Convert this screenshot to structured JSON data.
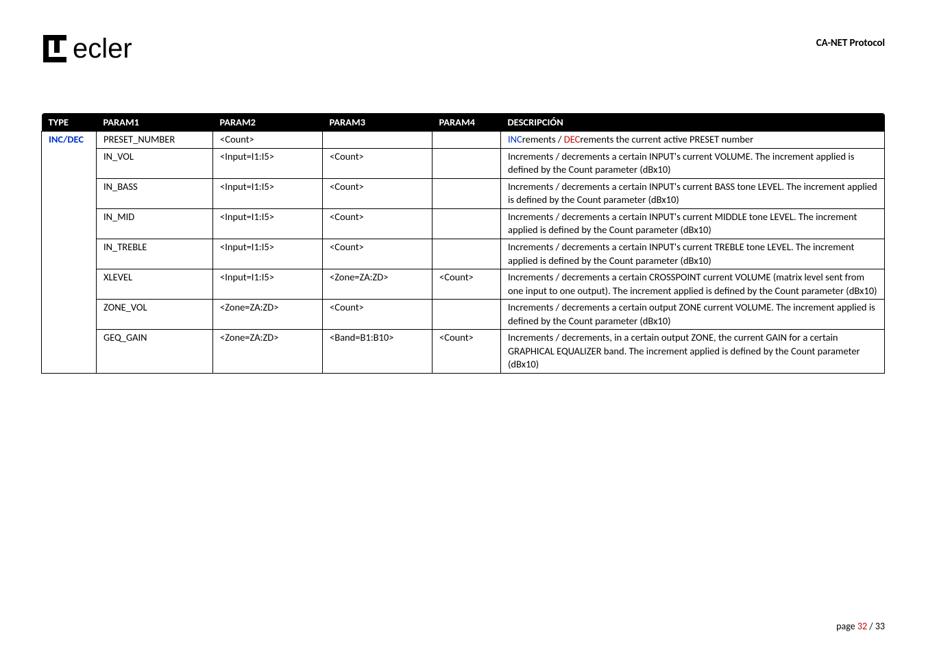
{
  "header": {
    "logo_text": "ecler",
    "doc_title": "CA-NET Protocol"
  },
  "table": {
    "headers": {
      "type": "TYPE",
      "param1": "PARAM1",
      "param2": "PARAM2",
      "param3": "PARAM3",
      "param4": "PARAM4",
      "desc": "DESCRIPCIÓN"
    },
    "type_label": "INC/DEC",
    "rows": [
      {
        "param1": "PRESET_NUMBER",
        "param2": "<Count>",
        "param3": "",
        "param4": "",
        "desc_prefix_inc": "INC",
        "desc_mid1": "rements / ",
        "desc_prefix_dec": "DEC",
        "desc_rest": "rements the current active PRESET number"
      },
      {
        "param1": "IN_VOL",
        "param2": "<Input=I1:I5>",
        "param3": "<Count>",
        "param4": "",
        "desc": "Increments / decrements a certain INPUT's  current VOLUME. The increment applied is defined by the Count parameter (dBx10)"
      },
      {
        "param1": "IN_BASS",
        "param2": "<Input=I1:I5>",
        "param3": "<Count>",
        "param4": "",
        "desc": "Increments / decrements a certain INPUT's current BASS tone LEVEL. The increment applied is defined by the Count parameter (dBx10)"
      },
      {
        "param1": "IN_MID",
        "param2": "<Input=I1:I5>",
        "param3": "<Count>",
        "param4": "",
        "desc": "Increments / decrements a certain INPUT's current MIDDLE tone LEVEL. The increment applied is defined by the Count parameter (dBx10)"
      },
      {
        "param1": "IN_TREBLE",
        "param2": "<Input=I1:I5>",
        "param3": "<Count>",
        "param4": "",
        "desc": "Increments / decrements a certain INPUT's current TREBLE tone LEVEL. The increment applied is defined by the Count parameter (dBx10)"
      },
      {
        "param1": "XLEVEL",
        "param2": "<Input=I1:I5>",
        "param3": "<Zone=ZA:ZD>",
        "param4": "<Count>",
        "desc": "Increments / decrements a certain CROSSPOINT current VOLUME (matrix level sent from one input to one output). The increment applied is defined by the Count parameter (dBx10)"
      },
      {
        "param1": "ZONE_VOL",
        "param2": "<Zone=ZA:ZD>",
        "param3": "<Count>",
        "param4": "",
        "desc": "Increments / decrements a certain output ZONE current VOLUME. The increment applied is defined by the Count parameter (dBx10)"
      },
      {
        "param1": "GEQ_GAIN",
        "param2": "<Zone=ZA:ZD>",
        "param3": "<Band=B1:B10>",
        "param4": "<Count>",
        "desc": "Increments / decrements, in a certain output ZONE, the current GAIN for a certain GRAPHICAL EQUALIZER band. The increment applied is defined by the Count parameter (dBx10)"
      }
    ]
  },
  "footer": {
    "label": "page  ",
    "current": "32",
    "sep": " / ",
    "total": "33"
  }
}
